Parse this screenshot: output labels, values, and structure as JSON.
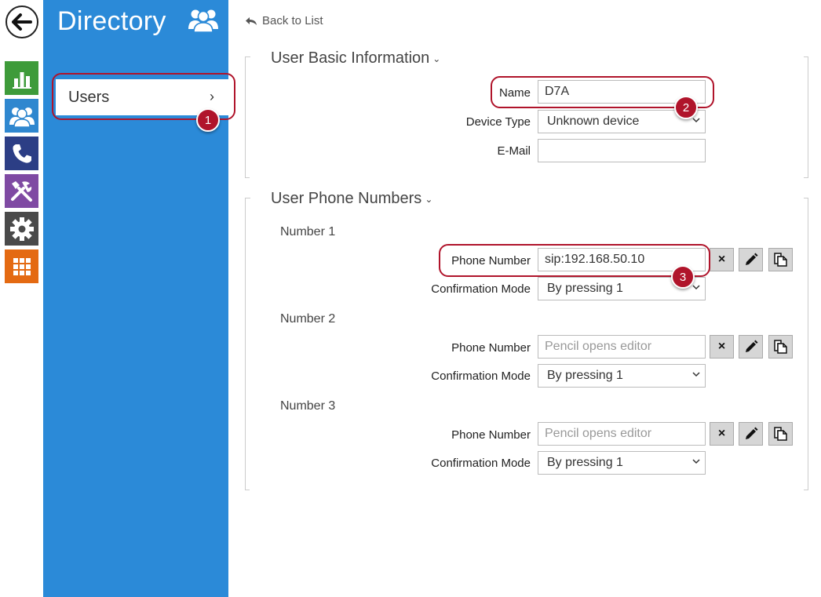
{
  "sidebar": {
    "title": "Directory",
    "items": [
      {
        "label": "Users",
        "chevron": "›"
      }
    ]
  },
  "content": {
    "back_label": "Back to List",
    "basic_info": {
      "title": "User Basic Information",
      "name_label": "Name",
      "name_value": "D7A",
      "device_type_label": "Device Type",
      "device_type_value": "Unknown device",
      "email_label": "E-Mail",
      "email_value": ""
    },
    "phone_numbers": {
      "title": "User Phone Numbers",
      "groups": [
        {
          "label": "Number 1",
          "phone_label": "Phone Number",
          "phone_value": "sip:192.168.50.10",
          "mode_label": "Confirmation Mode",
          "mode_value": "By pressing 1"
        },
        {
          "label": "Number 2",
          "phone_label": "Phone Number",
          "phone_placeholder": "Pencil opens editor",
          "mode_label": "Confirmation Mode",
          "mode_value": "By pressing 1"
        },
        {
          "label": "Number 3",
          "phone_label": "Phone Number",
          "phone_placeholder": "Pencil opens editor",
          "mode_label": "Confirmation Mode",
          "mode_value": "By pressing 1"
        }
      ]
    }
  },
  "badges": [
    "1",
    "2",
    "3"
  ],
  "icons": {
    "clear": "×"
  },
  "colors": {
    "sidebar": "#2b8ad8",
    "callout": "#b0142b"
  }
}
